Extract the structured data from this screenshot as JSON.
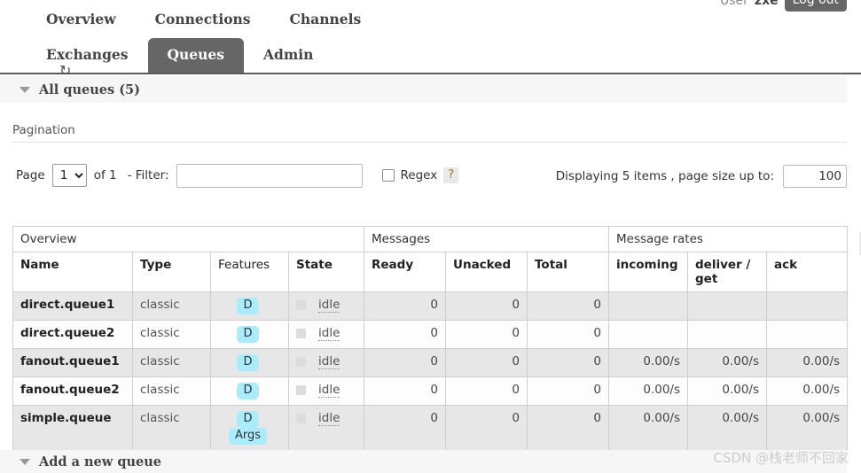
{
  "user": {
    "label": "User",
    "name": "zxe",
    "logout_label": "Log out"
  },
  "nav": {
    "row1": [
      {
        "label": "Overview",
        "active": false
      },
      {
        "label": "Connections",
        "active": false
      },
      {
        "label": "Channels",
        "active": false
      }
    ],
    "row2": [
      {
        "label": "Exchanges",
        "active": false
      },
      {
        "label": "Queues",
        "active": true
      },
      {
        "label": "Admin",
        "active": false
      }
    ]
  },
  "section": {
    "title": "All queues (5)",
    "caret_icon": "caret-down-icon",
    "refresh_icon": "refresh-icon"
  },
  "pagination": {
    "heading": "Pagination",
    "page_label": "Page",
    "page_value": "1",
    "page_options": [
      "1"
    ],
    "of_text": "of 1",
    "filter_label": "- Filter:",
    "filter_value": "",
    "filter_placeholder": "",
    "regex_label": "Regex",
    "regex_checked": false,
    "help_label": "?",
    "displaying_text": "Displaying 5 items , page size up to:",
    "page_size_value": "100"
  },
  "table": {
    "group_headers": [
      {
        "label": "Overview",
        "span": 4
      },
      {
        "label": "Messages",
        "span": 3
      },
      {
        "label": "Message rates",
        "span": 3
      }
    ],
    "columns": [
      {
        "label": "Name",
        "bold": true
      },
      {
        "label": "Type",
        "bold": true
      },
      {
        "label": "Features",
        "bold": false
      },
      {
        "label": "State",
        "bold": true
      },
      {
        "label": "Ready",
        "bold": true
      },
      {
        "label": "Unacked",
        "bold": true
      },
      {
        "label": "Total",
        "bold": true
      },
      {
        "label": "incoming",
        "bold": true
      },
      {
        "label": "deliver / get",
        "bold": true
      },
      {
        "label": "ack",
        "bold": true
      }
    ],
    "add_column_label": "+",
    "rows": [
      {
        "name": "direct.queue1",
        "type": "classic",
        "features": [
          "D"
        ],
        "state": "idle",
        "ready": "0",
        "unacked": "0",
        "total": "0",
        "incoming": "",
        "deliver_get": "",
        "ack": ""
      },
      {
        "name": "direct.queue2",
        "type": "classic",
        "features": [
          "D"
        ],
        "state": "idle",
        "ready": "0",
        "unacked": "0",
        "total": "0",
        "incoming": "",
        "deliver_get": "",
        "ack": ""
      },
      {
        "name": "fanout.queue1",
        "type": "classic",
        "features": [
          "D"
        ],
        "state": "idle",
        "ready": "0",
        "unacked": "0",
        "total": "0",
        "incoming": "0.00/s",
        "deliver_get": "0.00/s",
        "ack": "0.00/s"
      },
      {
        "name": "fanout.queue2",
        "type": "classic",
        "features": [
          "D"
        ],
        "state": "idle",
        "ready": "0",
        "unacked": "0",
        "total": "0",
        "incoming": "0.00/s",
        "deliver_get": "0.00/s",
        "ack": "0.00/s"
      },
      {
        "name": "simple.queue",
        "type": "classic",
        "features": [
          "D",
          "Args"
        ],
        "state": "idle",
        "ready": "0",
        "unacked": "0",
        "total": "0",
        "incoming": "0.00/s",
        "deliver_get": "0.00/s",
        "ack": "0.00/s"
      }
    ]
  },
  "footer": {
    "title": "Add a new queue",
    "caret_icon": "caret-down-icon"
  },
  "watermark": "CSDN @栈老师不回家",
  "colors": {
    "active_tab": "#666666",
    "badge": "#a9ecfb",
    "row_odd": "#e7e7e7",
    "row_even": "#fdfdfd",
    "section_bar": "#f6f6f6",
    "help_text": "#b06a20"
  }
}
